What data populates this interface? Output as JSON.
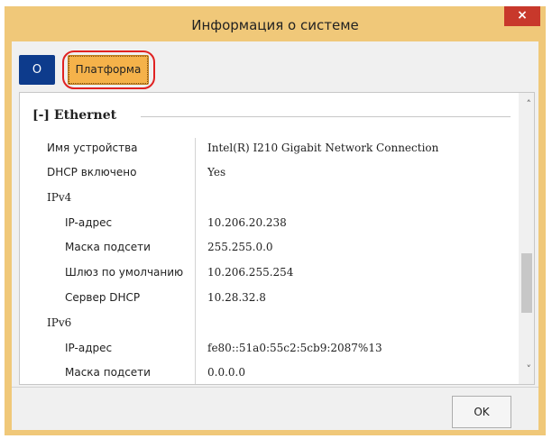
{
  "window": {
    "title": "Информация о системе",
    "close_label": "×"
  },
  "tabs": [
    {
      "label": "О"
    },
    {
      "label": "Платформа"
    }
  ],
  "section": {
    "header": "[-] Ethernet"
  },
  "rows": [
    {
      "label": "Имя устройства",
      "value": "Intel(R) I210 Gigabit Network Connection"
    },
    {
      "label": "DHCP включено",
      "value": "Yes"
    },
    {
      "label": "IPv4",
      "value": ""
    },
    {
      "label": "IP-адрес",
      "value": "10.206.20.238"
    },
    {
      "label": "Маска подсети",
      "value": "255.255.0.0"
    },
    {
      "label": "Шлюз по умолчанию",
      "value": "10.206.255.254"
    },
    {
      "label": "Сервер DHCP",
      "value": "10.28.32.8"
    },
    {
      "label": "IPv6",
      "value": ""
    },
    {
      "label": "IP-адрес",
      "value": "fe80::51a0:55c2:5cb9:2087%13"
    },
    {
      "label": "Маска подсети",
      "value": "0.0.0.0"
    }
  ],
  "buttons": {
    "ok": "OK"
  },
  "scrollbar": {
    "up": "˄",
    "down": "˅"
  },
  "colors": {
    "title_bar": "#f0c879",
    "close_button": "#c8382b",
    "tab_active": "#0d3b8c",
    "tab_selected": "#f5b24a",
    "highlight": "#e02222"
  }
}
